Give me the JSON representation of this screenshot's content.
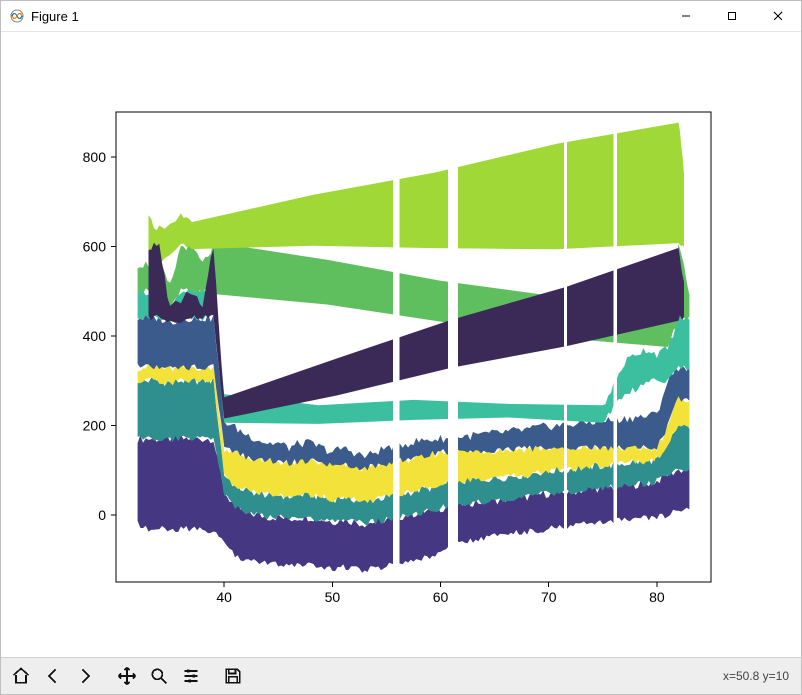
{
  "window": {
    "title": "Figure 1"
  },
  "toolbar": {
    "home": "Home",
    "back": "Back",
    "forward": "Forward",
    "pan": "Pan",
    "zoom": "Zoom",
    "configure": "Configure subplots",
    "save": "Save"
  },
  "statusbar": {
    "coords": "x=50.8 y=10"
  },
  "chart_data": {
    "type": "area",
    "title": "",
    "xlabel": "",
    "ylabel": "",
    "xlim": [
      30,
      85
    ],
    "ylim": [
      -150,
      900
    ],
    "xticks": [
      40,
      50,
      60,
      70,
      80
    ],
    "yticks": [
      0,
      200,
      400,
      600,
      800
    ],
    "colors": {
      "yellow": "#f2e23a",
      "teal": "#2f8f8f",
      "navy": "#3a5b8c",
      "purple": "#453781",
      "green": "#5fbf5f",
      "lime": "#9fd837",
      "darkpurple": "#3b2a58",
      "seagreen": "#3bbf9f"
    },
    "envelopes": [
      {
        "comment": "purple lowest band",
        "color": "#453781",
        "x": [
          32,
          33,
          34,
          35,
          36,
          37,
          38,
          39,
          40,
          41,
          42,
          43,
          44,
          45,
          46,
          47,
          48,
          49,
          50,
          51,
          52,
          53,
          54,
          55,
          56,
          57,
          58,
          59,
          60,
          61,
          62,
          63,
          64,
          65,
          66,
          67,
          68,
          69,
          70,
          71,
          72,
          73,
          74,
          75,
          76,
          77,
          78,
          79,
          80,
          81,
          82,
          83
        ],
        "low": [
          -20,
          -30,
          -30,
          -35,
          -30,
          -30,
          -35,
          -40,
          -60,
          -90,
          -100,
          -105,
          -110,
          -110,
          -115,
          -110,
          -110,
          -115,
          -120,
          -115,
          -120,
          -125,
          -120,
          -115,
          -110,
          -105,
          -100,
          -95,
          -90,
          -70,
          -60,
          -55,
          -50,
          -48,
          -45,
          -40,
          -38,
          -35,
          -30,
          -28,
          -25,
          -22,
          -20,
          -18,
          -15,
          -12,
          -10,
          -8,
          -5,
          0,
          10,
          10
        ],
        "high": [
          170,
          170,
          170,
          170,
          170,
          170,
          170,
          170,
          50,
          20,
          5,
          0,
          -5,
          -5,
          -10,
          -5,
          -5,
          -10,
          -15,
          -10,
          -15,
          -20,
          -15,
          -10,
          -5,
          0,
          5,
          10,
          15,
          20,
          25,
          28,
          30,
          32,
          35,
          38,
          40,
          45,
          48,
          50,
          52,
          55,
          58,
          60,
          62,
          65,
          68,
          70,
          75,
          90,
          100,
          100
        ]
      },
      {
        "comment": "teal mid band",
        "color": "#2f8f8f",
        "x": [
          32,
          33,
          34,
          35,
          36,
          37,
          38,
          39,
          40,
          41,
          42,
          43,
          44,
          45,
          46,
          47,
          48,
          49,
          50,
          51,
          52,
          53,
          54,
          55,
          56,
          57,
          58,
          59,
          60,
          61,
          62,
          63,
          64,
          65,
          66,
          67,
          68,
          69,
          70,
          71,
          72,
          73,
          74,
          75,
          76,
          77,
          78,
          79,
          80,
          81,
          82,
          83
        ],
        "low": [
          170,
          170,
          170,
          170,
          170,
          170,
          170,
          170,
          50,
          20,
          5,
          0,
          -5,
          -5,
          -10,
          -5,
          -5,
          -10,
          -15,
          -10,
          -15,
          -20,
          -15,
          -10,
          -5,
          0,
          5,
          10,
          15,
          20,
          25,
          28,
          30,
          32,
          35,
          38,
          40,
          45,
          48,
          50,
          52,
          55,
          58,
          60,
          62,
          65,
          68,
          70,
          75,
          90,
          100,
          100
        ],
        "high": [
          300,
          300,
          300,
          295,
          300,
          300,
          300,
          300,
          90,
          65,
          55,
          50,
          45,
          45,
          40,
          45,
          45,
          40,
          35,
          40,
          35,
          30,
          35,
          40,
          45,
          50,
          55,
          60,
          65,
          70,
          75,
          78,
          80,
          82,
          85,
          88,
          90,
          95,
          98,
          100,
          102,
          105,
          108,
          110,
          112,
          115,
          118,
          120,
          125,
          160,
          200,
          200
        ]
      },
      {
        "comment": "yellow band",
        "color": "#f2e23a",
        "x": [
          32,
          33,
          34,
          35,
          36,
          37,
          38,
          39,
          40,
          41,
          42,
          43,
          44,
          45,
          46,
          47,
          48,
          49,
          50,
          51,
          52,
          53,
          54,
          55,
          56,
          57,
          58,
          59,
          60,
          61,
          62,
          63,
          64,
          65,
          66,
          67,
          68,
          69,
          70,
          71,
          72,
          73,
          74,
          75,
          76,
          77,
          78,
          79,
          80,
          81,
          82,
          83
        ],
        "low": [
          300,
          300,
          300,
          295,
          300,
          300,
          300,
          300,
          90,
          65,
          55,
          50,
          45,
          45,
          40,
          45,
          45,
          40,
          35,
          40,
          35,
          30,
          35,
          40,
          45,
          50,
          55,
          60,
          65,
          70,
          75,
          78,
          80,
          82,
          85,
          88,
          90,
          95,
          98,
          100,
          102,
          105,
          108,
          110,
          112,
          115,
          118,
          120,
          125,
          160,
          200,
          200
        ],
        "high": [
          330,
          330,
          330,
          325,
          330,
          330,
          330,
          330,
          150,
          138,
          130,
          125,
          120,
          120,
          115,
          120,
          120,
          115,
          110,
          115,
          110,
          105,
          110,
          115,
          120,
          125,
          130,
          135,
          140,
          140,
          142,
          143,
          144,
          145,
          146,
          147,
          148,
          149,
          150,
          150,
          150,
          150,
          150,
          150,
          150,
          150,
          150,
          150,
          150,
          200,
          260,
          260
        ]
      },
      {
        "comment": "navy upper band",
        "color": "#3a5b8c",
        "x": [
          32,
          33,
          34,
          35,
          36,
          37,
          38,
          39,
          40,
          41,
          42,
          43,
          44,
          45,
          46,
          47,
          48,
          49,
          50,
          51,
          52,
          53,
          54,
          55,
          56,
          57,
          58,
          59,
          60,
          61,
          62,
          63,
          64,
          65,
          66,
          67,
          68,
          69,
          70,
          71,
          72,
          73,
          74,
          75,
          76,
          77,
          78,
          79,
          80,
          81,
          82,
          83
        ],
        "low": [
          330,
          330,
          330,
          325,
          330,
          330,
          330,
          330,
          150,
          138,
          130,
          125,
          120,
          120,
          115,
          120,
          120,
          115,
          110,
          115,
          110,
          105,
          110,
          115,
          120,
          125,
          130,
          135,
          140,
          140,
          142,
          143,
          144,
          145,
          146,
          147,
          148,
          149,
          150,
          150,
          150,
          150,
          150,
          150,
          150,
          150,
          150,
          150,
          150,
          200,
          260,
          260
        ],
        "high": [
          440,
          440,
          440,
          430,
          440,
          440,
          440,
          440,
          210,
          195,
          180,
          170,
          160,
          160,
          150,
          160,
          160,
          150,
          140,
          150,
          140,
          130,
          140,
          150,
          155,
          160,
          165,
          168,
          170,
          172,
          175,
          177,
          180,
          182,
          185,
          188,
          190,
          195,
          198,
          200,
          202,
          205,
          208,
          210,
          212,
          215,
          218,
          220,
          225,
          300,
          330,
          330
        ]
      },
      {
        "comment": "seagreen light band (upper, partial)",
        "color": "#3bbf9f",
        "x": [
          32,
          33,
          34,
          35,
          36,
          37,
          38,
          39,
          40,
          75,
          76,
          77,
          78,
          79,
          80,
          81,
          82,
          83
        ],
        "low": [
          440,
          440,
          440,
          430,
          440,
          440,
          440,
          440,
          210,
          210,
          240,
          270,
          280,
          300,
          300,
          300,
          330,
          330
        ],
        "high": [
          500,
          500,
          500,
          470,
          500,
          500,
          500,
          500,
          260,
          240,
          290,
          340,
          360,
          370,
          360,
          370,
          440,
          440
        ]
      },
      {
        "comment": "green band (top-ish, partial)",
        "color": "#5fbf5f",
        "x": [
          32,
          33,
          34,
          35,
          36,
          37,
          38,
          39,
          81,
          82,
          83
        ],
        "low": [
          500,
          500,
          500,
          470,
          500,
          500,
          500,
          500,
          370,
          440,
          440
        ],
        "high": [
          560,
          560,
          560,
          510,
          600,
          600,
          560,
          600,
          440,
          600,
          500
        ]
      },
      {
        "comment": "lime spikes",
        "color": "#9fd837",
        "x": [
          33,
          34,
          36,
          37,
          82,
          82.5
        ],
        "low": [
          560,
          560,
          600,
          600,
          600,
          600
        ],
        "high": [
          660,
          640,
          670,
          650,
          880,
          760
        ]
      },
      {
        "comment": "dark purple spikes",
        "color": "#3b2a58",
        "x": [
          33,
          34,
          35,
          37,
          38,
          39,
          40,
          82,
          82.5
        ],
        "low": [
          440,
          440,
          430,
          440,
          440,
          440,
          210,
          440,
          440
        ],
        "high": [
          600,
          600,
          460,
          500,
          460,
          600,
          260,
          600,
          520
        ]
      }
    ],
    "gaps": [
      {
        "x0": 55.6,
        "x1": 56.2
      },
      {
        "x0": 60.7,
        "x1": 61.6
      },
      {
        "x0": 71.4,
        "x1": 71.7
      },
      {
        "x0": 76.0,
        "x1": 76.3
      }
    ]
  }
}
